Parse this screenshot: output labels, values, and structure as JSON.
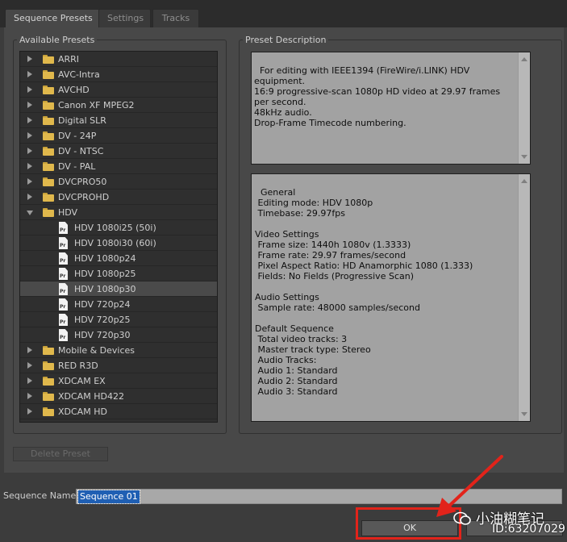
{
  "tabs": [
    {
      "label": "Sequence Presets",
      "active": true
    },
    {
      "label": "Settings",
      "active": false
    },
    {
      "label": "Tracks",
      "active": false
    }
  ],
  "available_presets": {
    "title": "Available Presets",
    "items": [
      {
        "label": "ARRI",
        "type": "folder",
        "expanded": false
      },
      {
        "label": "AVC-Intra",
        "type": "folder",
        "expanded": false
      },
      {
        "label": "AVCHD",
        "type": "folder",
        "expanded": false
      },
      {
        "label": "Canon XF MPEG2",
        "type": "folder",
        "expanded": false
      },
      {
        "label": "Digital SLR",
        "type": "folder",
        "expanded": false
      },
      {
        "label": "DV - 24P",
        "type": "folder",
        "expanded": false
      },
      {
        "label": "DV - NTSC",
        "type": "folder",
        "expanded": false
      },
      {
        "label": "DV - PAL",
        "type": "folder",
        "expanded": false
      },
      {
        "label": "DVCPRO50",
        "type": "folder",
        "expanded": false
      },
      {
        "label": "DVCPROHD",
        "type": "folder",
        "expanded": false
      },
      {
        "label": "HDV",
        "type": "folder",
        "expanded": true
      },
      {
        "label": "HDV 1080i25 (50i)",
        "type": "preset",
        "selected": false
      },
      {
        "label": "HDV 1080i30 (60i)",
        "type": "preset",
        "selected": false
      },
      {
        "label": "HDV 1080p24",
        "type": "preset",
        "selected": false
      },
      {
        "label": "HDV 1080p25",
        "type": "preset",
        "selected": false
      },
      {
        "label": "HDV 1080p30",
        "type": "preset",
        "selected": true
      },
      {
        "label": "HDV 720p24",
        "type": "preset",
        "selected": false
      },
      {
        "label": "HDV 720p25",
        "type": "preset",
        "selected": false
      },
      {
        "label": "HDV 720p30",
        "type": "preset",
        "selected": false
      },
      {
        "label": "Mobile & Devices",
        "type": "folder",
        "expanded": false
      },
      {
        "label": "RED R3D",
        "type": "folder",
        "expanded": false
      },
      {
        "label": "XDCAM EX",
        "type": "folder",
        "expanded": false
      },
      {
        "label": "XDCAM HD422",
        "type": "folder",
        "expanded": false
      },
      {
        "label": "XDCAM HD",
        "type": "folder",
        "expanded": false
      }
    ],
    "file_icon_text": "Pr"
  },
  "preset_description": {
    "title": "Preset Description",
    "description": "For editing with IEEE1394 (FireWire/i.LINK) HDV equipment.\n16:9 progressive-scan 1080p HD video at 29.97 frames per second.\n48kHz audio.\nDrop-Frame Timecode numbering.",
    "details": "General\n Editing mode: HDV 1080p\n Timebase: 29.97fps\n\nVideo Settings\n Frame size: 1440h 1080v (1.3333)\n Frame rate: 29.97 frames/second\n Pixel Aspect Ratio: HD Anamorphic 1080 (1.333)\n Fields: No Fields (Progressive Scan)\n\nAudio Settings\n Sample rate: 48000 samples/second\n\nDefault Sequence\n Total video tracks: 3\n Master track type: Stereo\n Audio Tracks:\n Audio 1: Standard\n Audio 2: Standard\n Audio 3: Standard"
  },
  "buttons": {
    "delete_preset": "Delete Preset",
    "ok": "OK"
  },
  "sequence_name": {
    "label": "Sequence Name:",
    "value": "Sequence 01"
  },
  "watermark": {
    "line1": "小油糊笔记",
    "line2": "ID:63207029"
  },
  "colors": {
    "annotation_red": "#e2231a",
    "selection_blue": "#1f5fb3",
    "folder_yellow": "#e0b84c"
  }
}
